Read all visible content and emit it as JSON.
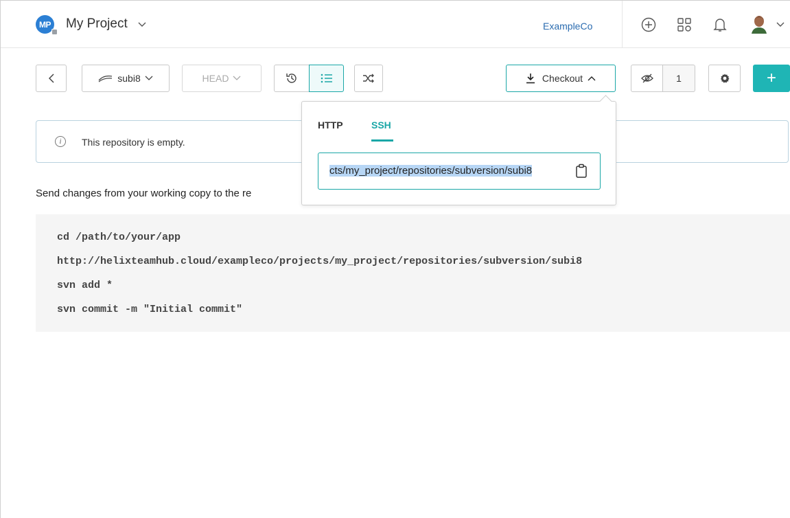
{
  "header": {
    "project_initials": "MP",
    "project_name": "My Project",
    "organization": "ExampleCo",
    "icons": [
      "add-circle-icon",
      "apps-grid-icon",
      "bell-icon",
      "user-avatar"
    ]
  },
  "toolbar": {
    "back_icon": "chevron-left-icon",
    "branch_label": "subi8",
    "head_label": "HEAD",
    "checkout_label": "Checkout",
    "watch_count": "1",
    "add_label": "+"
  },
  "info": {
    "message": "This repository is empty."
  },
  "instructions": {
    "text": "Send changes from your working copy to the re"
  },
  "code": {
    "lines": [
      "cd /path/to/your/app",
      "http://helixteamhub.cloud/exampleco/projects/my_project/repositories/subversion/subi8",
      "svn add *",
      "svn commit -m \"Initial commit\""
    ]
  },
  "checkout_popover": {
    "tabs": [
      "HTTP",
      "SSH"
    ],
    "active_tab": "SSH",
    "url_value": "cts/my_project/repositories/subversion/subi8"
  },
  "colors": {
    "accent": "#1aa7a7",
    "link": "#2b6cb0",
    "avatar": "#2b7fd4"
  }
}
